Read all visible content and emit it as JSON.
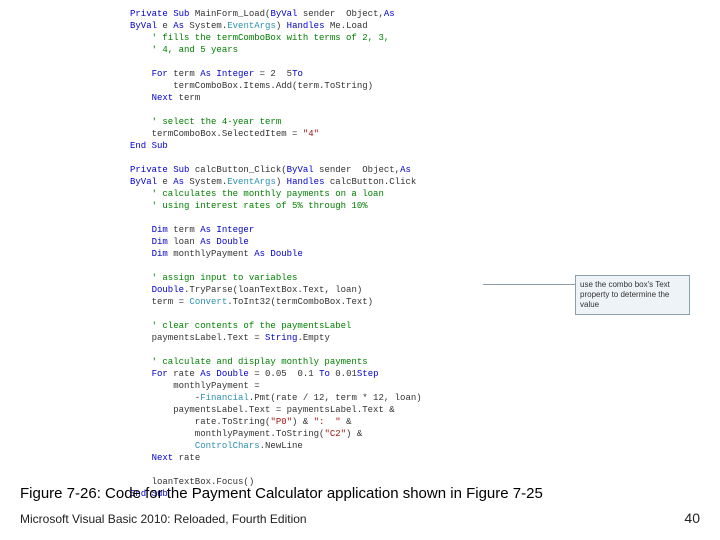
{
  "code": {
    "lines": [
      {
        "cls": "kw",
        "text": "Private Sub",
        "tail": " MainForm_Load(",
        "kw2": "ByVal",
        "tail2": " sender ",
        "kw3": "As",
        "tail3": " Object,"
      },
      {
        "cls": "kw",
        "text": "ByVal",
        "tail": " e ",
        "kw2": "As",
        "tail2": " System.",
        "typ": "EventArgs",
        "tail3": ") ",
        "kw3": "Handles",
        "tail4": " Me.Load"
      },
      {
        "cls": "com",
        "text": "    ' fills the termComboBox with terms of 2, 3,"
      },
      {
        "cls": "com",
        "text": "    ' 4, and 5 years"
      },
      {
        "cls": "plain",
        "text": ""
      },
      {
        "cls": "kw",
        "text": "    For",
        "tail": " term ",
        "kw2": "As Integer",
        "tail2": " = 2 ",
        "kw3": "To",
        "tail3": " 5"
      },
      {
        "cls": "plain",
        "text": "        termComboBox.Items.Add(term.ToString)"
      },
      {
        "cls": "kw",
        "text": "    Next",
        "tail": " term"
      },
      {
        "cls": "plain",
        "text": ""
      },
      {
        "cls": "com",
        "text": "    ' select the 4-year term"
      },
      {
        "cls": "plain",
        "text": "    termComboBox.SelectedItem = ",
        "str": "\"4\""
      },
      {
        "cls": "kw",
        "text": "End Sub"
      },
      {
        "cls": "plain",
        "text": ""
      },
      {
        "cls": "kw",
        "text": "Private Sub",
        "tail": " calcButton_Click(",
        "kw2": "ByVal",
        "tail2": " sender ",
        "kw3": "As",
        "tail3": " Object,"
      },
      {
        "cls": "kw",
        "text": "ByVal",
        "tail": " e ",
        "kw2": "As",
        "tail2": " System.",
        "typ": "EventArgs",
        "tail3": ") ",
        "kw3": "Handles",
        "tail4": " calcButton.Click"
      },
      {
        "cls": "com",
        "text": "    ' calculates the monthly payments on a loan"
      },
      {
        "cls": "com",
        "text": "    ' using interest rates of 5% through 10%"
      },
      {
        "cls": "plain",
        "text": ""
      },
      {
        "cls": "kw",
        "text": "    Dim",
        "tail": " term ",
        "kw2": "As Integer"
      },
      {
        "cls": "kw",
        "text": "    Dim",
        "tail": " loan ",
        "kw2": "As Double"
      },
      {
        "cls": "kw",
        "text": "    Dim",
        "tail": " monthlyPayment ",
        "kw2": "As Double"
      },
      {
        "cls": "plain",
        "text": ""
      },
      {
        "cls": "com",
        "text": "    ' assign input to variables"
      },
      {
        "cls": "kw",
        "text": "    Double",
        "tail": ".TryParse(loanTextBox.Text, loan)"
      },
      {
        "cls": "plain",
        "text": "    term = ",
        "typ": "Convert",
        "tail2": ".ToInt32(termComboBox.Text)"
      },
      {
        "cls": "plain",
        "text": ""
      },
      {
        "cls": "com",
        "text": "    ' clear contents of the paymentsLabel"
      },
      {
        "cls": "plain",
        "text": "    paymentsLabel.Text = ",
        "kw": "String",
        "tail2": ".Empty"
      },
      {
        "cls": "plain",
        "text": ""
      },
      {
        "cls": "com",
        "text": "    ' calculate and display monthly payments"
      },
      {
        "cls": "kw",
        "text": "    For",
        "tail": " rate ",
        "kw2": "As Double",
        "tail2": " = 0.05 ",
        "kw3": "To",
        "tail3": " 0.1 ",
        "kw4": "Step",
        "tail4": " 0.01"
      },
      {
        "cls": "plain",
        "text": "        monthlyPayment ="
      },
      {
        "cls": "plain",
        "text": "            -",
        "typ": "Financial",
        "tail2": ".Pmt(rate / 12, term * 12, loan)"
      },
      {
        "cls": "plain",
        "text": "        paymentsLabel.Text = paymentsLabel.Text &"
      },
      {
        "cls": "plain",
        "text": "            rate.ToString(",
        "str": "\"P0\"",
        "tail2": ") & ",
        "str2": "\":  \"",
        "tail3": " &"
      },
      {
        "cls": "plain",
        "text": "            monthlyPayment.ToString(",
        "str": "\"C2\"",
        "tail2": ") &"
      },
      {
        "cls": "plain",
        "text": "            ",
        "typ": "ControlChars",
        "tail2": ".NewLine"
      },
      {
        "cls": "kw",
        "text": "    Next",
        "tail": " rate"
      },
      {
        "cls": "plain",
        "text": ""
      },
      {
        "cls": "plain",
        "text": "    loanTextBox.Focus()"
      },
      {
        "cls": "kw",
        "text": "End Sub"
      }
    ]
  },
  "callout": "use the combo box's Text property to determine the value",
  "caption": "Figure 7-26: Code for the Payment Calculator application shown in Figure 7-25",
  "footer_left": "Microsoft Visual Basic 2010: Reloaded, Fourth Edition",
  "footer_right": "40"
}
